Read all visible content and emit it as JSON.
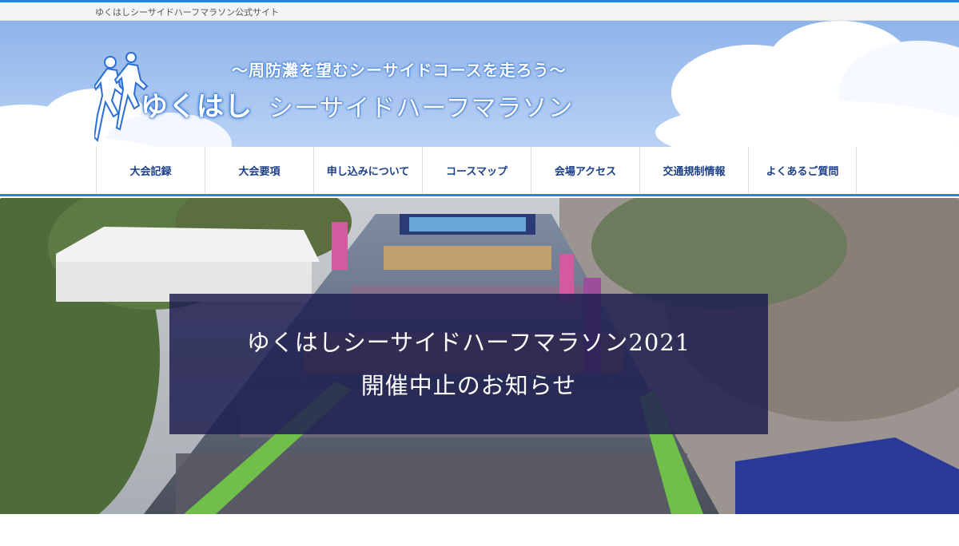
{
  "topbar": {
    "site_label": "ゆくはしシーサイドハーフマラソン公式サイト"
  },
  "header": {
    "tagline": "〜周防灘を望むシーサイドコースを走ろう〜",
    "logo_main": "ゆくはし",
    "logo_sub": "シーサイドハーフマラソン"
  },
  "nav": {
    "items": [
      {
        "label": "大会記録"
      },
      {
        "label": "大会要項"
      },
      {
        "label": "申し込みについて"
      },
      {
        "label": "コースマップ"
      },
      {
        "label": "会場アクセス"
      },
      {
        "label": "交通規制情報"
      },
      {
        "label": "よくあるご質問"
      }
    ]
  },
  "hero": {
    "notice_line1": "ゆくはしシーサイドハーフマラソン2021",
    "notice_line2": "開催中止のお知らせ"
  },
  "colors": {
    "accent": "#1e86e8",
    "nav_text": "#1c3f8a",
    "notice_bg": "#1e1e50"
  }
}
